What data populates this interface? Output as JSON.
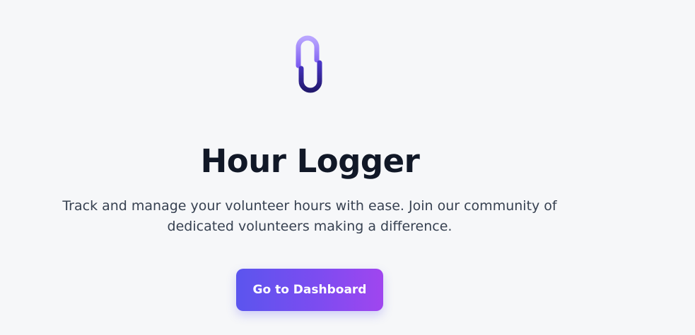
{
  "app": {
    "logo_icon": "chain-link-s-logo-icon",
    "title": "Hour Logger",
    "subtitle": "Track and manage your volunteer hours with ease. Join our community of dedicated volunteers making a difference.",
    "cta_label": "Go to Dashboard"
  },
  "colors": {
    "background": "#f6f7f9",
    "title": "#111827",
    "subtitle": "#374151",
    "cta_gradient_start": "#5b55ee",
    "cta_gradient_end": "#a046ef",
    "logo_light": "#a78bfa",
    "logo_dark": "#2e1f86"
  }
}
